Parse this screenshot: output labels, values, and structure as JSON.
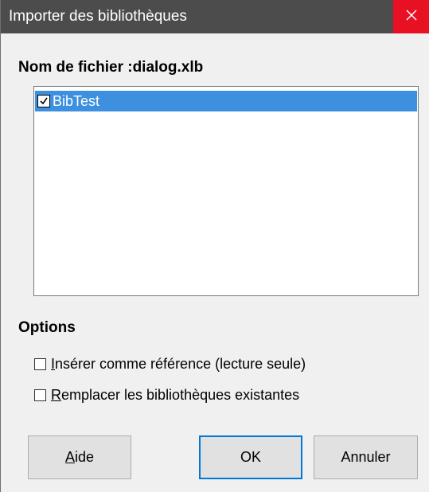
{
  "window": {
    "title": "Importer des bibliothèques"
  },
  "file": {
    "heading": "Nom de fichier :dialog.xlb"
  },
  "libraries": [
    {
      "label": "BibTest",
      "checked": true,
      "selected": true
    }
  ],
  "options": {
    "heading": "Options",
    "insert_reference": {
      "mnemonic": "I",
      "rest": "nsérer comme référence (lecture seule)",
      "checked": false
    },
    "replace_existing": {
      "mnemonic": "R",
      "rest": "emplacer les bibliothèques existantes",
      "checked": false
    }
  },
  "buttons": {
    "help": {
      "mnemonic": "A",
      "rest": "ide"
    },
    "ok": "OK",
    "cancel": "Annuler"
  },
  "colors": {
    "titlebar": "#4c4c4c",
    "close_hover": "#e81123",
    "selection": "#3d8fe0",
    "default_button_border": "#0078d7"
  },
  "icons": {
    "close": "close-icon",
    "checkmark": "checkmark-icon"
  }
}
